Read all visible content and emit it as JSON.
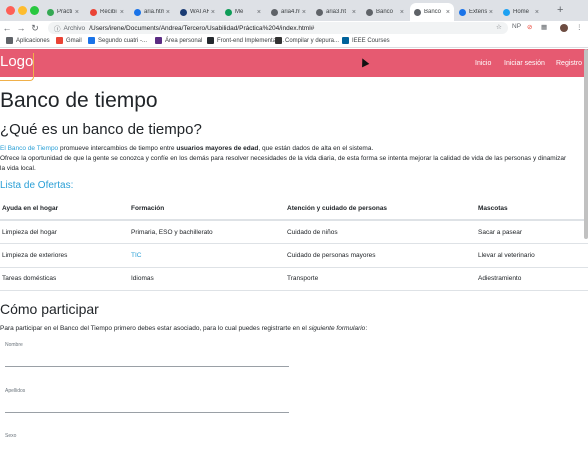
{
  "browser": {
    "tabs": [
      {
        "label": "Prácti",
        "fav": "#34a853",
        "active": false
      },
      {
        "label": "Recibi",
        "fav": "#ea4335",
        "active": false
      },
      {
        "label": "aria.htm",
        "fav": "#1a73e8",
        "active": false
      },
      {
        "label": "WAI ARI",
        "fav": "#1a3b73",
        "active": false
      },
      {
        "label": "Me",
        "fav": "#0f9d58",
        "active": false
      },
      {
        "label": "aria4.ht",
        "fav": "#5f6368",
        "active": false
      },
      {
        "label": "aria3.ht",
        "fav": "#5f6368",
        "active": false
      },
      {
        "label": "Banco",
        "fav": "#5f6368",
        "active": false
      },
      {
        "label": "Banco",
        "fav": "#5f6368",
        "active": true
      },
      {
        "label": "Extens",
        "fav": "#1a73e8",
        "active": false
      },
      {
        "label": "Home",
        "fav": "#1da1f2",
        "active": false
      }
    ],
    "url_prefix": "Archivo",
    "url": "/Users/irene/Documents/Andrea/Tercero/Usabilidad/Práctica%204/index.html#",
    "bookmarks": [
      {
        "label": "Aplicaciones",
        "icon": "apps-icon"
      },
      {
        "label": "Gmail",
        "icon": "gmail-icon"
      },
      {
        "label": "Segundo cuatri -...",
        "icon": "drive-icon"
      },
      {
        "label": "Área personal",
        "icon": "moodle-icon"
      },
      {
        "label": "Front-end Implementati...",
        "icon": "github-icon"
      },
      {
        "label": "Compilar y depura...",
        "icon": "m-icon"
      },
      {
        "label": "IEEE Courses",
        "icon": "ieee-icon"
      }
    ]
  },
  "site": {
    "logo": "Logo",
    "nav": [
      "Inicio",
      "Iniciar sesión",
      "Registro"
    ]
  },
  "content": {
    "title": "Banco de tiempo",
    "subtitle": "¿Qué es un banco de tiempo?",
    "intro_link": "El Banco de Tiempo",
    "intro_pre": " promueve intercambios de tiempo entre ",
    "intro_bold": "usuarios mayores de edad",
    "intro_post": ", que están dados de alta en el sistema.",
    "intro_line2": "Ofrece la oportunidad de que la gente se conozca y confíe en los demás para resolver necesidades de la vida diaria, de esta forma se intenta mejorar la calidad de vida de las personas y dinamizar",
    "intro_line3": "la vida local.",
    "ofertas_title": "Lista de Ofertas:",
    "table": {
      "headers": [
        "Ayuda en el hogar",
        "Formación",
        "Atención y cuidado de personas",
        "Mascotas"
      ],
      "rows": [
        [
          "Limpieza del hogar",
          "Primaria, ESO y bachillerato",
          "Cuidado de niños",
          "Sacar a pasear"
        ],
        [
          "Limpieza de exteriores",
          "TIC",
          "Cuidado de personas mayores",
          "Llevar al veterinario"
        ],
        [
          "Tareas domésticas",
          "Idiomas",
          "Transporte",
          "Adiestramiento"
        ]
      ]
    },
    "participar_title": "Cómo participar",
    "participar_text": "Para participar en el Banco del Tiempo primero debes estar asociado, para lo cual puedes registrarte en el ",
    "participar_em": "siguiente formulario",
    "participar_end": ":",
    "form": {
      "nombre": "Nombre",
      "apellidos": "Apellidos",
      "sexo": "Sexo"
    }
  },
  "colors": {
    "navbar": "#e65a71",
    "link": "#2a9fd6"
  }
}
